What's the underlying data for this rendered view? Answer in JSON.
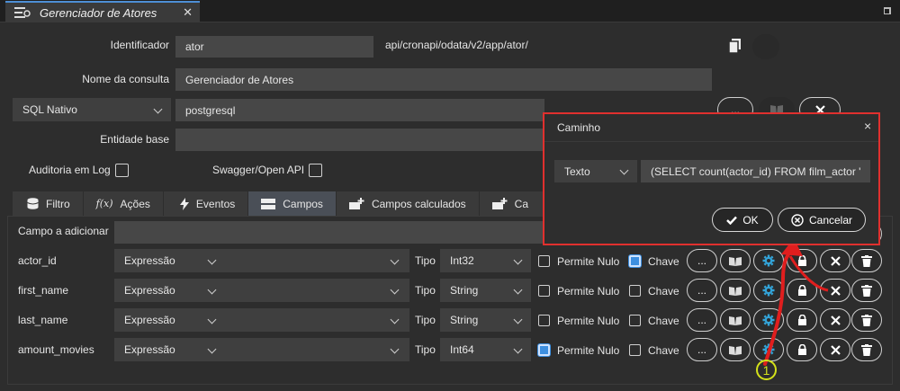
{
  "tab": {
    "title": "Gerenciador de Atores",
    "close": "✕"
  },
  "form": {
    "identificador_label": "Identificador",
    "identificador_value": "ator",
    "url": "api/cronapi/odata/v2/app/ator/",
    "nome_label": "Nome da consulta",
    "nome_value": "Gerenciador de Atores",
    "source_select": "SQL Nativo",
    "source_value": "postgresql",
    "entidade_label": "Entidade base",
    "auditoria_label": "Auditoria em Log",
    "swagger_label": "Swagger/Open API",
    "dots": "..."
  },
  "tabs": [
    {
      "label": "Filtro",
      "icon": "database-icon"
    },
    {
      "label": "Ações",
      "icon": "function-icon"
    },
    {
      "label": "Eventos",
      "icon": "bolt-icon"
    },
    {
      "label": "Campos",
      "icon": "fields-icon"
    },
    {
      "label": "Campos calculados",
      "icon": "add-calculated-icon"
    },
    {
      "label": "Ca",
      "icon": "add-calculated-icon"
    }
  ],
  "campo_label": "Campo a adicionar",
  "field_labels": {
    "tipo": "Tipo",
    "nullable": "Permite Nulo",
    "key": "Chave",
    "dots": "..."
  },
  "fields": [
    {
      "name": "actor_id",
      "kind": "Expressão",
      "type": "Int32",
      "nullable": false,
      "key": true
    },
    {
      "name": "first_name",
      "kind": "Expressão",
      "type": "String",
      "nullable": false,
      "key": false
    },
    {
      "name": "last_name",
      "kind": "Expressão",
      "type": "String",
      "nullable": false,
      "key": false
    },
    {
      "name": "amount_movies",
      "kind": "Expressão",
      "type": "Int64",
      "nullable": true,
      "key": false
    }
  ],
  "dialog": {
    "title": "Caminho",
    "close": "×",
    "mode": "Texto",
    "expression": "(SELECT count(actor_id) FROM film_actor '",
    "ok": "OK",
    "cancel": "Cancelar"
  },
  "annotation": {
    "step": "1",
    "color": "#e01e1e",
    "badge_color": "#d4e21a"
  }
}
